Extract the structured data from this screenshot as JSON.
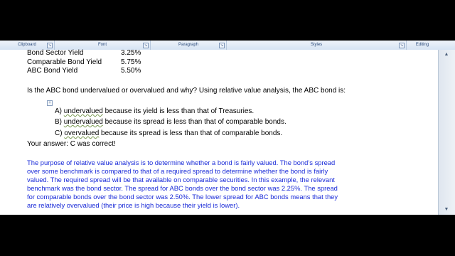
{
  "ribbon": {
    "groups": [
      "Clipboard",
      "Font",
      "Paragraph",
      "Styles",
      "Editing"
    ]
  },
  "table": {
    "rows": [
      {
        "label": "Bond Sector Yield",
        "value": "3.25%"
      },
      {
        "label": "Comparable Bond Yield",
        "value": "5.75%"
      },
      {
        "label": "ABC Bond Yield",
        "value": "5.50%"
      }
    ]
  },
  "question": "Is the ABC bond undervalued or overvalued and why? Using relative value analysis, the ABC bond is:",
  "options": [
    {
      "letter": "A)",
      "key": "undervalued",
      "rest": " because its yield is less than that of Treasuries."
    },
    {
      "letter": "B)",
      "key": "undervalued",
      "rest": " because its spread is less than that of comparable bonds."
    },
    {
      "letter": "C)",
      "key": "overvalued",
      "rest": " because its spread is less than that of comparable bonds."
    }
  ],
  "answer": "Your answer: C was correct!",
  "explanation": [
    "The purpose of relative value analysis is to determine whether a bond is fairly valued. The bond’s spread",
    "over some benchmark is compared to that of a required spread to determine whether the bond is fairly",
    "valued. The required spread will be that available on comparable securities. In this example, the relevant",
    "benchmark was the bond sector. The spread for ABC bonds over the bond sector was 2.25%. The spread",
    "for comparable bonds over the bond sector was 2.50%. The lower spread for ABC bonds means that they",
    "are relatively overvalued (their price is high because their yield is lower)."
  ]
}
